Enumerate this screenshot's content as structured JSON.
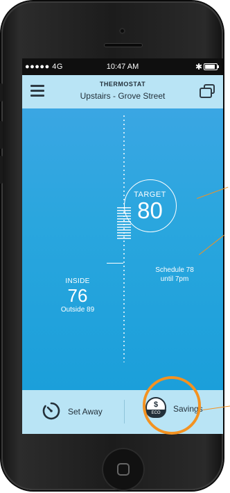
{
  "status_bar": {
    "carrier": "●●●●● 4G",
    "time": "10:47 AM",
    "bluetooth": "bluetooth-icon",
    "battery": "battery-icon"
  },
  "header": {
    "title": "THERMOSTAT",
    "subtitle": "Upstairs - Grove Street",
    "menu_icon": "hamburger-menu-icon",
    "devices_icon": "devices-icon"
  },
  "thermostat": {
    "target_label": "TARGET",
    "target_value": "80",
    "schedule_line1": "Schedule 78",
    "schedule_line2": "until 7pm",
    "inside_label": "INSIDE",
    "inside_value": "76",
    "outside_text": "Outside 89",
    "mode_icon": "snowflake-icon",
    "mode_symbol": "❄"
  },
  "bottom_bar": {
    "set_away_label": "Set Away",
    "savings_label": "Savings",
    "savings_coin_symbol": "$",
    "savings_coin_caption": "ECO"
  },
  "colors": {
    "main_blue": "#2baadf",
    "light_blue": "#b9e4f5",
    "accent_orange": "#f39221"
  }
}
